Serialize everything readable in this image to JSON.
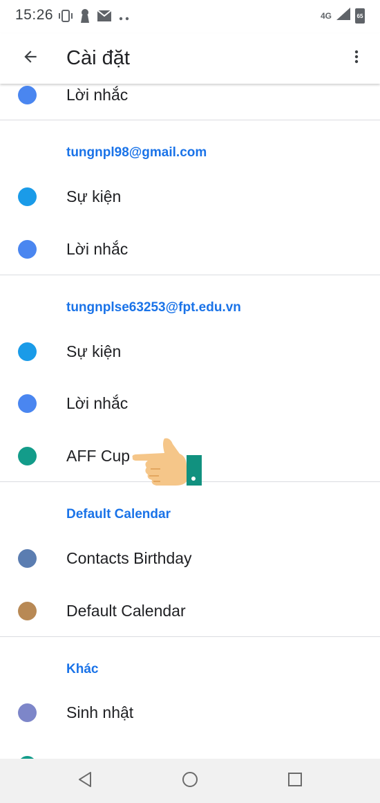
{
  "status_bar": {
    "time": "15:26",
    "network": "4G",
    "battery": "65",
    "icons": [
      "vibrate-icon",
      "keyhole-icon",
      "mail-icon",
      "more-dots-icon",
      "signal-icon",
      "battery-icon"
    ]
  },
  "app_bar": {
    "title": "Cài đặt",
    "back_icon": "arrow-back-icon",
    "more_icon": "more-vert-icon"
  },
  "sections": [
    {
      "header": "",
      "items": [
        {
          "label": "Lời nhắc",
          "color": "#4a86f0"
        }
      ]
    },
    {
      "header": "tungnpl98@gmail.com",
      "items": [
        {
          "label": "Sự kiện",
          "color": "#1a9be8"
        },
        {
          "label": "Lời nhắc",
          "color": "#4a86f0"
        }
      ]
    },
    {
      "header": "tungnplse63253@fpt.edu.vn",
      "items": [
        {
          "label": "Sự kiện",
          "color": "#1a9be8"
        },
        {
          "label": "Lời nhắc",
          "color": "#4a86f0"
        },
        {
          "label": "AFF Cup",
          "color": "#139c8a"
        }
      ]
    },
    {
      "header": "Default Calendar",
      "items": [
        {
          "label": "Contacts Birthday",
          "color": "#5b7db1"
        },
        {
          "label": "Default Calendar",
          "color": "#b88955"
        }
      ]
    },
    {
      "header": "Khác",
      "items": [
        {
          "label": "Sinh nhật",
          "color": "#7d86c9"
        },
        {
          "label": "",
          "color": "#139c8a"
        }
      ]
    }
  ],
  "nav_bar": {
    "icons": [
      "nav-back-icon",
      "nav-home-icon",
      "nav-recents-icon"
    ]
  },
  "colors": {
    "accent": "#1a73e8",
    "divider": "#dadce0",
    "nav_bar_bg": "#f1f1f1"
  }
}
